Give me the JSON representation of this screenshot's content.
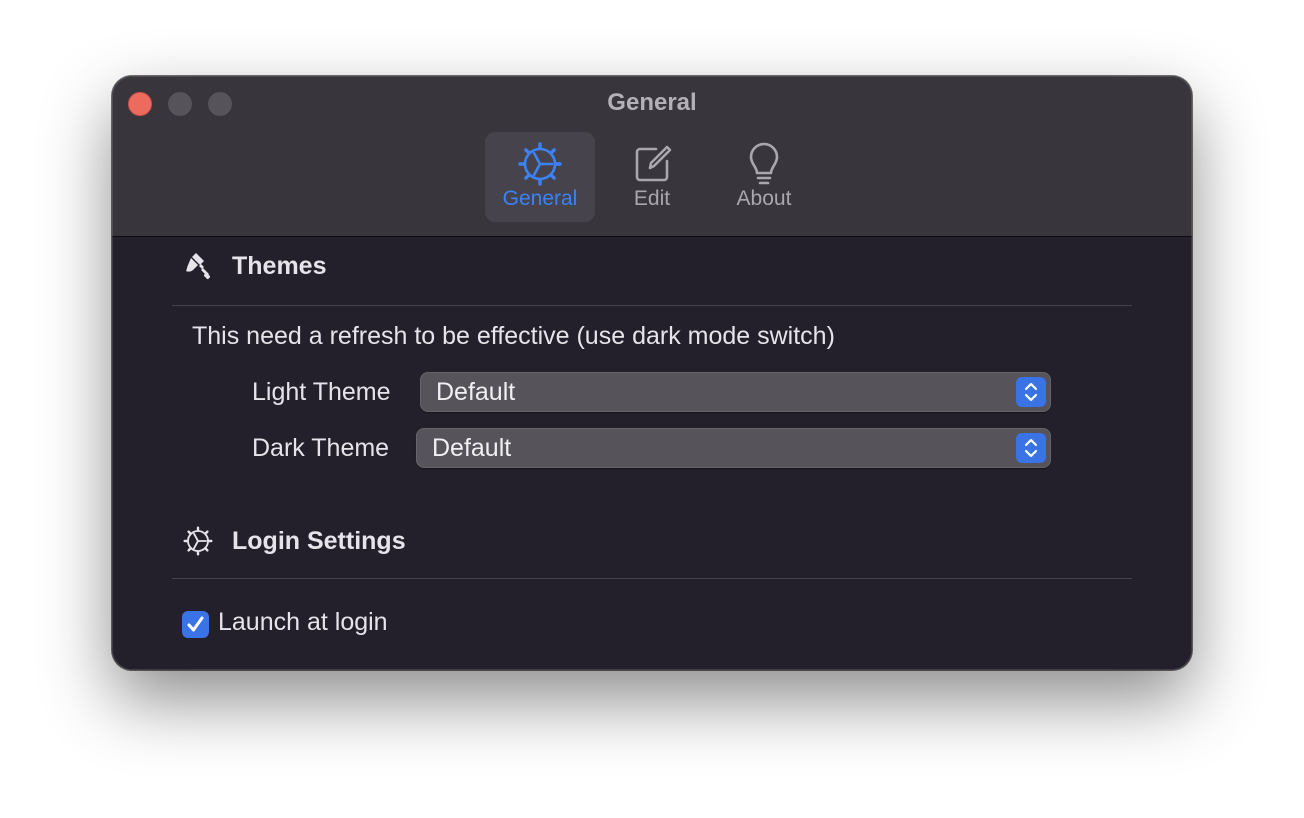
{
  "window": {
    "title": "General"
  },
  "toolbar": {
    "tabs": [
      {
        "label": "General",
        "icon": "gear-icon",
        "active": true
      },
      {
        "label": "Edit",
        "icon": "edit-icon",
        "active": false
      },
      {
        "label": "About",
        "icon": "lightbulb-icon",
        "active": false
      }
    ]
  },
  "themes": {
    "title": "Themes",
    "icon": "paintbrush-icon",
    "note": "This need a refresh to be effective (use dark mode switch)",
    "light_label": "Light Theme",
    "light_value": "Default",
    "dark_label": "Dark Theme",
    "dark_value": "Default"
  },
  "login": {
    "title": "Login Settings",
    "icon": "gear-icon",
    "launch_label": "Launch at login",
    "launch_checked": true
  },
  "colors": {
    "accent": "#3b82f6",
    "close": "#ed6a5e",
    "background": "#23202b",
    "titlebar": "#38353d"
  }
}
